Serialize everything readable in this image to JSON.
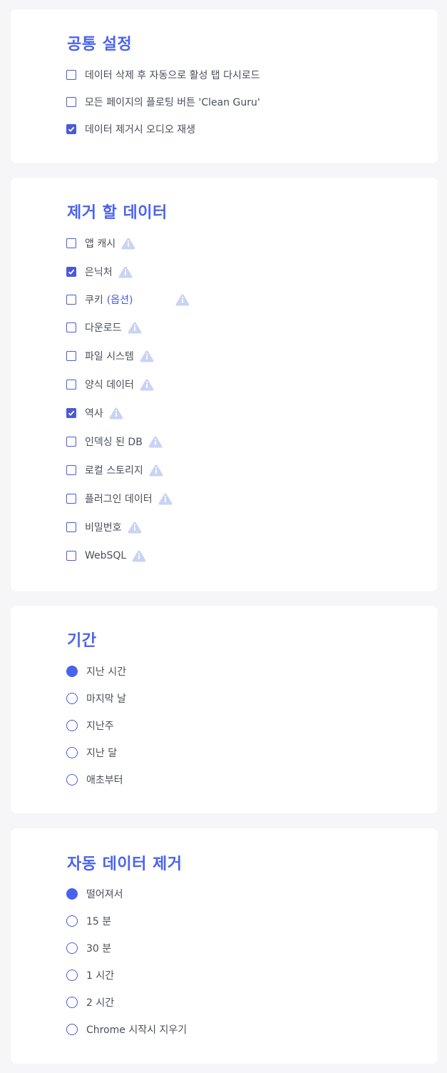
{
  "colors": {
    "accent": "#4a63ee",
    "checkbox": "#4a5bd6",
    "warn_icon": "#c9d3f4",
    "text": "#4a4f5c",
    "background": "#f6f6f8"
  },
  "common": {
    "title": "공통 설정",
    "options": [
      {
        "label": "데이터 삭제 후 자동으로 활성 탭 다시로드",
        "checked": false
      },
      {
        "label": "모든 페이지의 플로팅 버튼 'Clean Guru'",
        "checked": false
      },
      {
        "label": "데이터 제거시 오디오 재생",
        "checked": true
      }
    ]
  },
  "data_to_remove": {
    "title": "제거 할 데이터",
    "items": [
      {
        "label": "앱 캐시",
        "checked": false,
        "icon": "warning-icon"
      },
      {
        "label": "은닉처",
        "checked": true,
        "icon": "warning-icon"
      },
      {
        "label": "쿠키",
        "suffix": "(옵션)",
        "checked": false,
        "icon": "warning-icon"
      },
      {
        "label": "다운로드",
        "checked": false,
        "icon": "warning-icon"
      },
      {
        "label": "파일 시스템",
        "checked": false,
        "icon": "warning-icon"
      },
      {
        "label": "양식 데이터",
        "checked": false,
        "icon": "warning-icon"
      },
      {
        "label": "역사",
        "checked": true,
        "icon": "warning-icon"
      },
      {
        "label": "인덱싱 된 DB",
        "checked": false,
        "icon": "warning-icon"
      },
      {
        "label": "로컬 스토리지",
        "checked": false,
        "icon": "warning-icon"
      },
      {
        "label": "플러그인 데이터",
        "checked": false,
        "icon": "warning-icon"
      },
      {
        "label": "비밀번호",
        "checked": false,
        "icon": "warning-icon"
      },
      {
        "label": "WebSQL",
        "checked": false,
        "icon": "warning-icon"
      }
    ]
  },
  "period": {
    "title": "기간",
    "options": [
      {
        "label": "지난 시간",
        "selected": true
      },
      {
        "label": "마지막 날",
        "selected": false
      },
      {
        "label": "지난주",
        "selected": false
      },
      {
        "label": "지난 달",
        "selected": false
      },
      {
        "label": "애초부터",
        "selected": false
      }
    ]
  },
  "auto_remove": {
    "title": "자동 데이터 제거",
    "options": [
      {
        "label": "떨어져서",
        "selected": true
      },
      {
        "label": "15 분",
        "selected": false
      },
      {
        "label": "30 분",
        "selected": false
      },
      {
        "label": "1 시간",
        "selected": false
      },
      {
        "label": "2 시간",
        "selected": false
      },
      {
        "label": "Chrome 시작시 지우기",
        "selected": false
      }
    ]
  }
}
